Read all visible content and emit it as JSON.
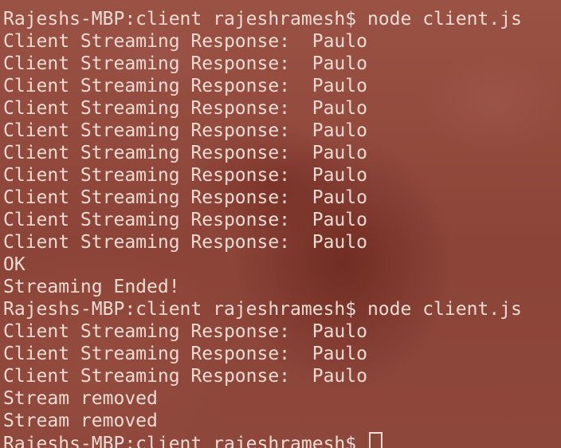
{
  "terminal": {
    "lines": [
      "Rajeshs-MBP:client rajeshramesh$ node client.js",
      "Client Streaming Response:  Paulo",
      "Client Streaming Response:  Paulo",
      "Client Streaming Response:  Paulo",
      "Client Streaming Response:  Paulo",
      "Client Streaming Response:  Paulo",
      "Client Streaming Response:  Paulo",
      "Client Streaming Response:  Paulo",
      "Client Streaming Response:  Paulo",
      "Client Streaming Response:  Paulo",
      "Client Streaming Response:  Paulo",
      "OK",
      "Streaming Ended!",
      "Rajeshs-MBP:client rajeshramesh$ node client.js",
      "Client Streaming Response:  Paulo",
      "Client Streaming Response:  Paulo",
      "Client Streaming Response:  Paulo",
      "Stream removed",
      "Stream removed"
    ],
    "prompt": "Rajeshs-MBP:client rajeshramesh$ "
  },
  "colors": {
    "text": "#eedcd4",
    "background": "#91493d"
  }
}
